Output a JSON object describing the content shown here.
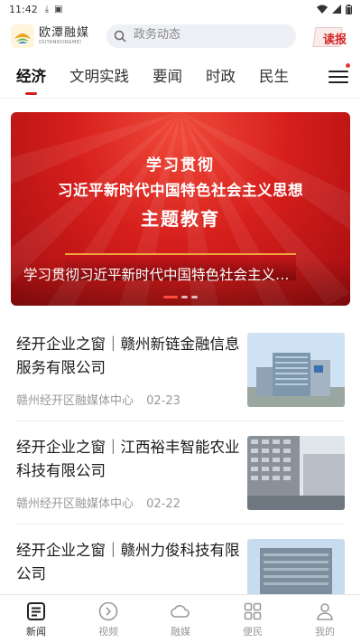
{
  "status_bar": {
    "time": "11:42"
  },
  "header": {
    "logo_cn": "欧潭融媒",
    "logo_en": "OUTANRONGMEI",
    "search_placeholder": "政务动态",
    "read_paper_label": "读报"
  },
  "tabs": [
    {
      "label": "经济",
      "active": true
    },
    {
      "label": "文明实践",
      "active": false
    },
    {
      "label": "要闻",
      "active": false
    },
    {
      "label": "时政",
      "active": false
    },
    {
      "label": "民生",
      "active": false
    }
  ],
  "banner": {
    "line1": "学习贯彻",
    "line2": "习近平新时代中国特色社会主义思想",
    "line3": "主题教育",
    "caption": "学习贯彻习近平新时代中国特色社会主义…",
    "slide_count": 3,
    "active_slide": 0
  },
  "news": [
    {
      "title": "经开企业之窗｜赣州新链金融信息服务有限公司",
      "source": "赣州经开区融媒体中心",
      "date": "02-23"
    },
    {
      "title": "经开企业之窗｜江西裕丰智能农业科技有限公司",
      "source": "赣州经开区融媒体中心",
      "date": "02-22"
    },
    {
      "title": "经开企业之窗｜赣州力俊科技有限公司",
      "source": "",
      "date": ""
    }
  ],
  "bottom_nav": [
    {
      "label": "新闻",
      "icon": "news-icon",
      "active": true
    },
    {
      "label": "视频",
      "icon": "video-icon",
      "active": false
    },
    {
      "label": "融媒",
      "icon": "cloud-icon",
      "active": false
    },
    {
      "label": "便民",
      "icon": "grid-icon",
      "active": false
    },
    {
      "label": "我的",
      "icon": "user-icon",
      "active": false
    }
  ],
  "colors": {
    "accent": "#d11f1f",
    "banner_red": "#d61f1c"
  }
}
